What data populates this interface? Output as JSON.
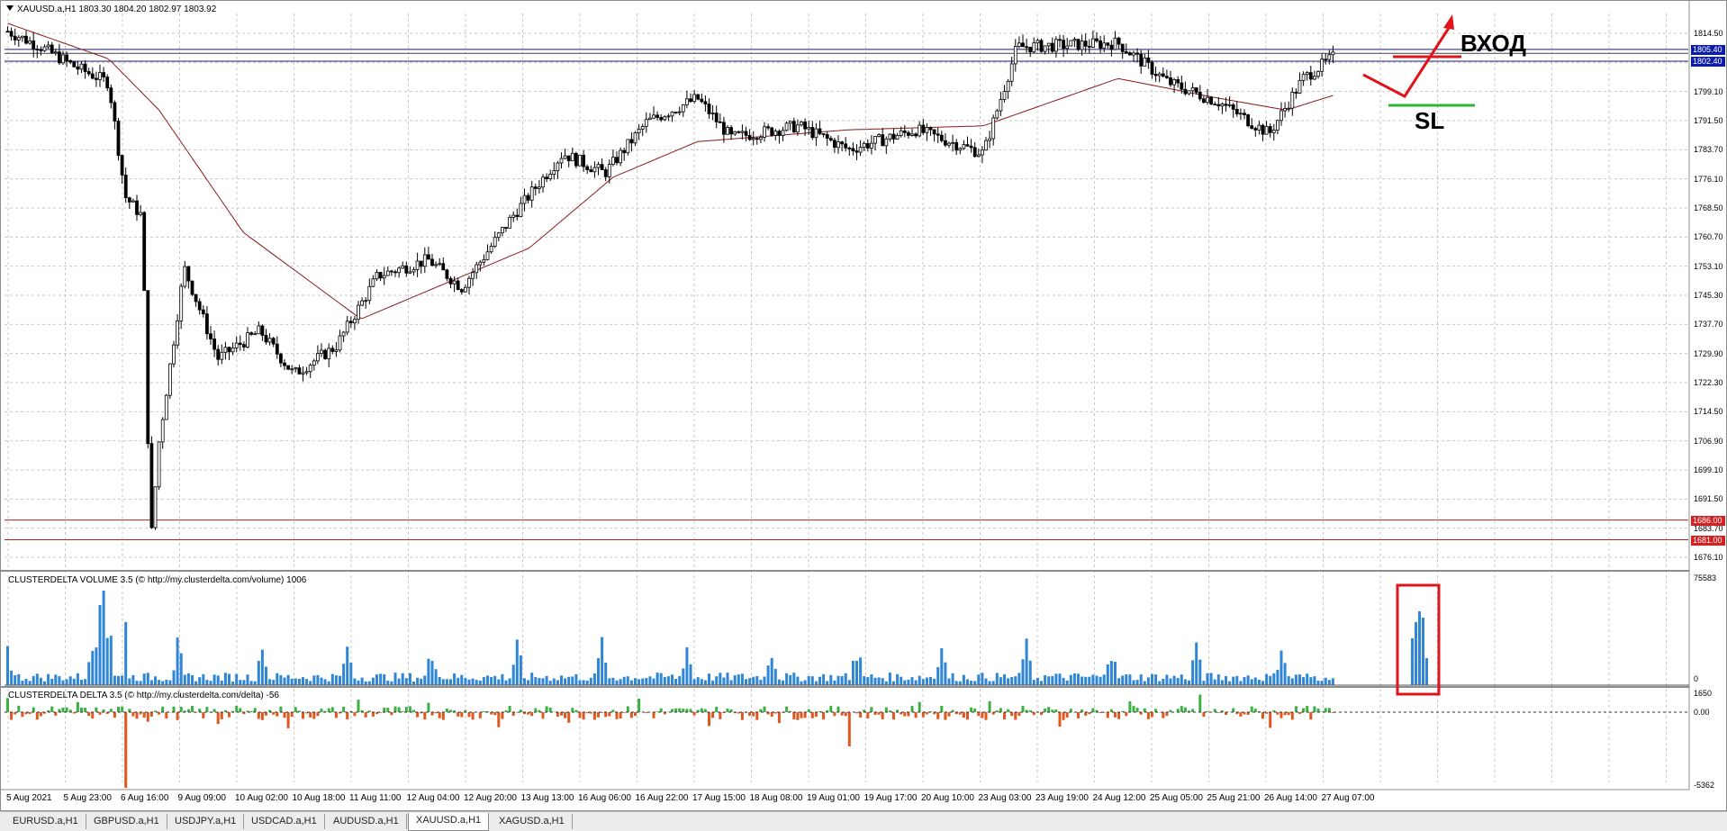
{
  "window": {
    "symbol_title": "XAUUSD.a,H1  1803.30 1804.20 1802.97 1803.92"
  },
  "price_scale": {
    "labels": [
      "1814.50",
      "1806.00",
      "1799.10",
      "1791.50",
      "1783.70",
      "1776.10",
      "1768.50",
      "1760.70",
      "1753.10",
      "1745.30",
      "1737.70",
      "1729.90",
      "1722.30",
      "1714.50",
      "1706.90",
      "1699.10",
      "1691.50",
      "1683.70",
      "1676.10"
    ],
    "tags": [
      {
        "text": "1805.40",
        "color": "#0b1ca8"
      },
      {
        "text": "1802.40",
        "color": "#0b1ca8"
      },
      {
        "text": "1686.00",
        "color": "#d32020"
      },
      {
        "text": "1681.00",
        "color": "#d32020"
      }
    ]
  },
  "indicators": {
    "volume": {
      "title": "CLUSTERDELTA VOLUME 3.5 (© http://my.clusterdelta.com/volume) 1006",
      "max_label": "75583",
      "min_label": "0"
    },
    "delta": {
      "title": "CLUSTERDELTA DELTA 3.5 (© http://my.clusterdelta.com/delta) -56",
      "max_label": "1650",
      "zero_label": "0.00",
      "min_label": "-5362"
    }
  },
  "time_axis": {
    "labels": [
      "5 Aug 2021",
      "5 Aug 23:00",
      "6 Aug 16:00",
      "9 Aug 09:00",
      "10 Aug 02:00",
      "10 Aug 18:00",
      "11 Aug 11:00",
      "12 Aug 04:00",
      "12 Aug 20:00",
      "13 Aug 13:00",
      "16 Aug 06:00",
      "16 Aug 22:00",
      "17 Aug 15:00",
      "18 Aug 08:00",
      "19 Aug 01:00",
      "19 Aug 17:00",
      "20 Aug 10:00",
      "23 Aug 03:00",
      "23 Aug 19:00",
      "24 Aug 12:00",
      "25 Aug 05:00",
      "25 Aug 21:00",
      "26 Aug 14:00",
      "27 Aug 07:00"
    ]
  },
  "annotations": {
    "entry_label": "ВХОД",
    "stop_label": "SL",
    "entry_color": "#e0141b",
    "stop_color": "#2fb52f"
  },
  "tabs": [
    "EURUSD.a,H1",
    "GBPUSD.a,H1",
    "USDJPY.a,H1",
    "USDCAD.a,H1",
    "AUDUSD.a,H1",
    "XAUUSD.a,H1",
    "XAGUSD.a,H1"
  ],
  "active_tab": "XAUUSD.a,H1",
  "chart_data": {
    "type": "candlestick",
    "symbol": "XAUUSD.a",
    "timeframe": "H1",
    "ylim": [
      1676.1,
      1814.5
    ],
    "close_anchors": [
      {
        "t": 0,
        "v": 1810
      },
      {
        "t": 0.02,
        "v": 1806
      },
      {
        "t": 0.04,
        "v": 1801
      },
      {
        "t": 0.06,
        "v": 1797
      },
      {
        "t": 0.07,
        "v": 1768
      },
      {
        "t": 0.08,
        "v": 1763
      },
      {
        "t": 0.085,
        "v": 1680
      },
      {
        "t": 0.09,
        "v": 1706
      },
      {
        "t": 0.105,
        "v": 1750
      },
      {
        "t": 0.125,
        "v": 1727
      },
      {
        "t": 0.15,
        "v": 1734
      },
      {
        "t": 0.17,
        "v": 1723
      },
      {
        "t": 0.195,
        "v": 1730
      },
      {
        "t": 0.22,
        "v": 1748
      },
      {
        "t": 0.25,
        "v": 1752
      },
      {
        "t": 0.27,
        "v": 1745
      },
      {
        "t": 0.3,
        "v": 1763
      },
      {
        "t": 0.33,
        "v": 1779
      },
      {
        "t": 0.355,
        "v": 1774
      },
      {
        "t": 0.38,
        "v": 1787
      },
      {
        "t": 0.41,
        "v": 1793
      },
      {
        "t": 0.43,
        "v": 1783
      },
      {
        "t": 0.47,
        "v": 1786
      },
      {
        "t": 0.5,
        "v": 1780
      },
      {
        "t": 0.54,
        "v": 1785
      },
      {
        "t": 0.58,
        "v": 1779
      },
      {
        "t": 0.6,
        "v": 1806
      },
      {
        "t": 0.66,
        "v": 1807
      },
      {
        "t": 0.69,
        "v": 1797
      },
      {
        "t": 0.72,
        "v": 1792
      },
      {
        "t": 0.75,
        "v": 1784
      },
      {
        "t": 0.77,
        "v": 1798
      },
      {
        "t": 0.79,
        "v": 1804
      }
    ],
    "moving_average_anchors": [
      {
        "t": 0,
        "v": 1812
      },
      {
        "t": 0.06,
        "v": 1803
      },
      {
        "t": 0.09,
        "v": 1790
      },
      {
        "t": 0.14,
        "v": 1759
      },
      {
        "t": 0.21,
        "v": 1737
      },
      {
        "t": 0.26,
        "v": 1746
      },
      {
        "t": 0.31,
        "v": 1755
      },
      {
        "t": 0.36,
        "v": 1773
      },
      {
        "t": 0.41,
        "v": 1782
      },
      {
        "t": 0.5,
        "v": 1785
      },
      {
        "t": 0.58,
        "v": 1786
      },
      {
        "t": 0.66,
        "v": 1798
      },
      {
        "t": 0.72,
        "v": 1793
      },
      {
        "t": 0.76,
        "v": 1790
      },
      {
        "t": 0.79,
        "v": 1794
      }
    ],
    "horizontal_levels": [
      1805.4,
      1802.4,
      1686.0,
      1681.0
    ],
    "volume_range": [
      0,
      75583
    ],
    "delta_range": [
      -5362,
      1650
    ]
  }
}
